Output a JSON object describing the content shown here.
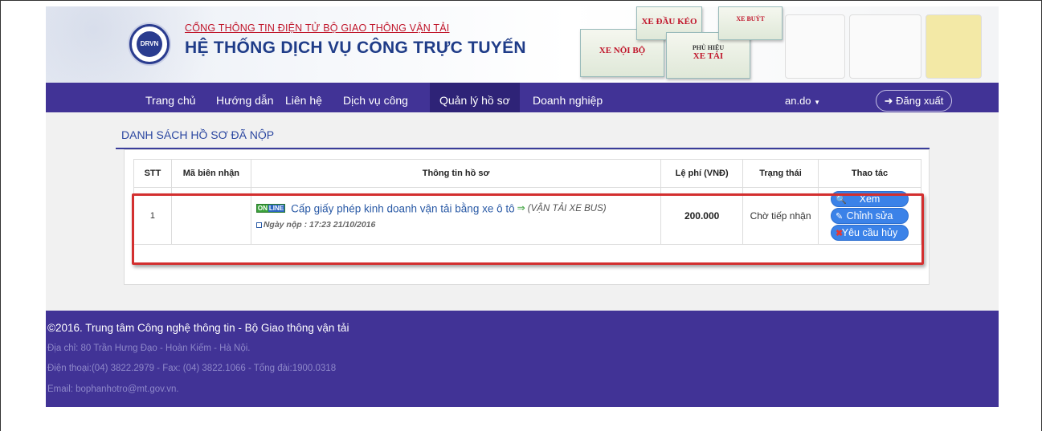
{
  "header": {
    "logo_text": "DRVN",
    "title_top": "CỔNG THÔNG TIN ĐIỆN TỬ BỘ GIAO THÔNG VẬN TẢI",
    "title_main": "HỆ THỐNG DỊCH VỤ CÔNG TRỰC TUYẾN",
    "cards": [
      "XE NỘI BỘ",
      "XE ĐẦU KÉO",
      "PHÙ HIỆU",
      "XE TẢI",
      "XE BUÝT"
    ]
  },
  "navbar": {
    "items": [
      "Trang chủ",
      "Hướng dẫn",
      "Liên hệ",
      "Dịch vụ công",
      "Quản lý hồ sơ",
      "Doanh nghiệp"
    ],
    "active": "Quản lý hồ sơ",
    "user": "an.do",
    "logout": "Đăng xuất"
  },
  "main": {
    "section_title": "DANH SÁCH HỒ SƠ ĐÃ NỘP",
    "columns": [
      "STT",
      "Mã biên nhận",
      "Thông tin hồ sơ",
      "Lệ phí (VNĐ)",
      "Trạng thái",
      "Thao tác"
    ],
    "rows": [
      {
        "stt": "1",
        "receipt_code": "",
        "badge_on": "ON",
        "badge_line": "LINE",
        "service": "Cấp giấy phép kinh doanh vận tải bằng xe ô tô",
        "arrow": "⇒",
        "kind": "(VẬN TẢI XE BUS)",
        "date": "Ngày nộp : 17:23 21/10/2016",
        "fee": "200.000",
        "status": "Chờ tiếp nhận",
        "actions": [
          "Xem",
          "Chỉnh sửa",
          "Yêu cầu hủy"
        ]
      }
    ]
  },
  "footer": {
    "copyright": "©2016. Trung tâm Công nghệ thông tin - Bộ Giao thông vận tải",
    "address": "Địa chỉ: 80 Trần Hưng Đạo - Hoàn Kiếm - Hà Nội.",
    "phone": "Điện thoại:(04) 3822.2979 - Fax: (04) 3822.1066 - Tổng đài:1900.0318",
    "email": "Email: bophanhotro@mt.gov.vn."
  },
  "colors": {
    "nav": "#413396",
    "accent_border": "#d32f2f",
    "button": "#3b82e8"
  }
}
